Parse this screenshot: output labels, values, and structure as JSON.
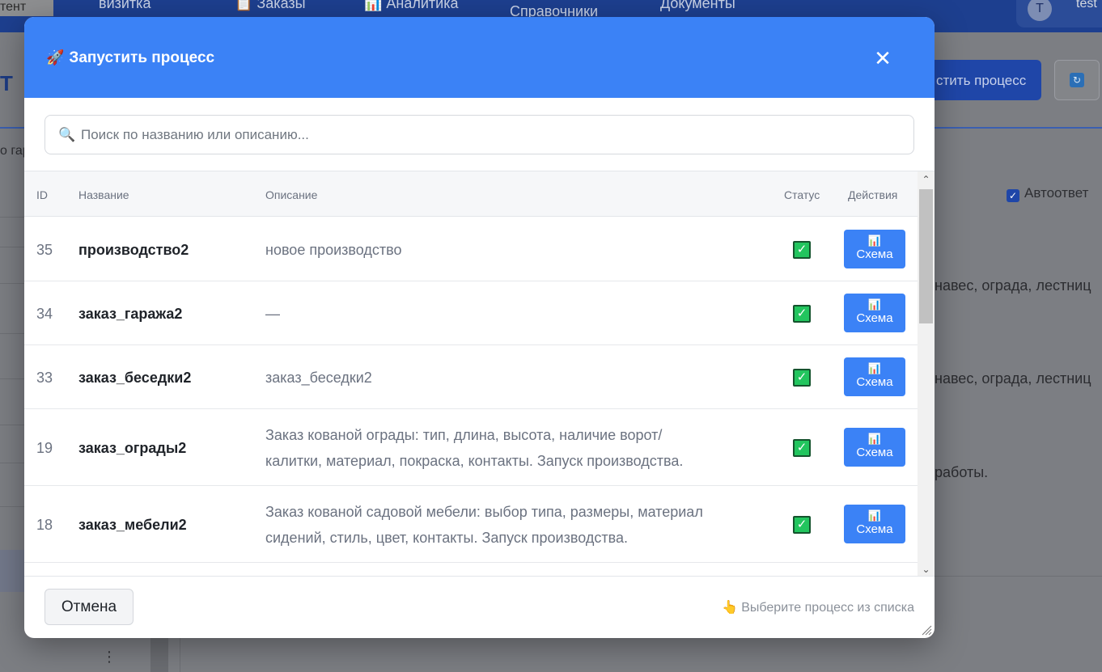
{
  "background": {
    "left_tab_label": "тент",
    "nav": [
      "визитка",
      "📋 Заказы",
      "📊 Аналитика",
      "Справочники",
      "Документы"
    ],
    "user_initial": "T",
    "user_name": "test",
    "page_letter": "Т",
    "truncated_label": "о гар",
    "launch_button_label": "стить процесс",
    "refresh_icon": "↻",
    "autoreply_label": "Автоответ",
    "row_texts": [
      "навес, ограда, лестниц",
      "навес, ограда, лестниц",
      "работы."
    ],
    "menu_dots": "⋮"
  },
  "modal": {
    "title_icon": "🚀",
    "title": "Запустить процесс",
    "close_symbol": "✕",
    "search": {
      "icon": "🔍",
      "placeholder": "Поиск по названию или описанию..."
    },
    "table": {
      "headers": {
        "id": "ID",
        "name": "Название",
        "description": "Описание",
        "status": "Статус",
        "actions": "Действия"
      },
      "rows": [
        {
          "id": "35",
          "name": "производство2",
          "description": "новое производство",
          "status": "✓",
          "action_icon": "📊",
          "action_label": "Схема"
        },
        {
          "id": "34",
          "name": "заказ_гаража2",
          "description": "—",
          "status": "✓",
          "action_icon": "📊",
          "action_label": "Схема"
        },
        {
          "id": "33",
          "name": "заказ_беседки2",
          "description": "заказ_беседки2",
          "status": "✓",
          "action_icon": "📊",
          "action_label": "Схема"
        },
        {
          "id": "19",
          "name": "заказ_ограды2",
          "description": "Заказ кованой ограды: тип, длина, высота, наличие ворот/калитки, материал, покраска, контакты. Запуск производства.",
          "status": "✓",
          "action_icon": "📊",
          "action_label": "Схема"
        },
        {
          "id": "18",
          "name": "заказ_мебели2",
          "description": "Заказ кованой садовой мебели: выбор типа, размеры, материал сидений, стиль, цвет, контакты. Запуск производства.",
          "status": "✓",
          "action_icon": "📊",
          "action_label": "Схема"
        }
      ]
    },
    "footer": {
      "cancel_label": "Отмена",
      "hint_icon": "👆",
      "hint": "Выберите процесс из списка"
    }
  },
  "colors": {
    "header_blue": "#3b82f6",
    "status_green": "#22c55e",
    "overlay_gray": "#7c7e83"
  }
}
